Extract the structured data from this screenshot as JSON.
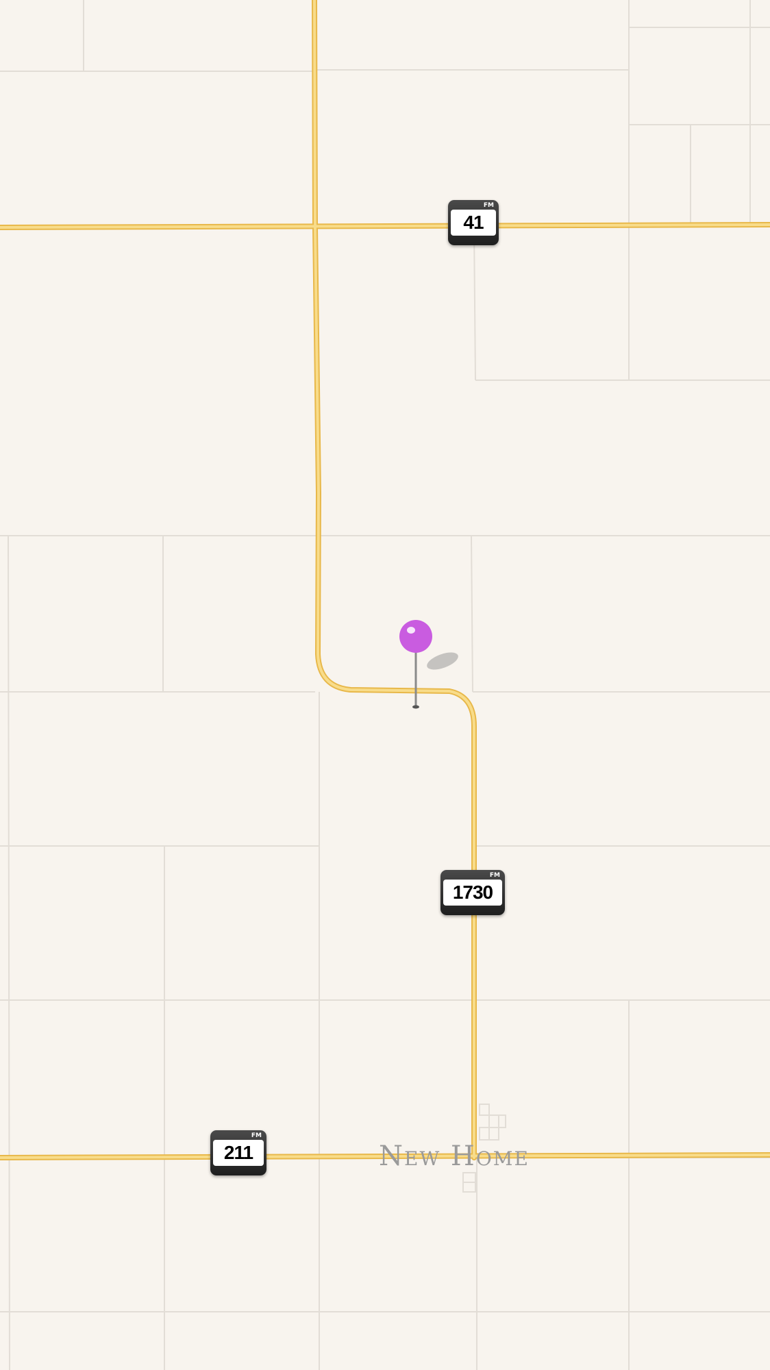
{
  "map": {
    "roads": [
      {
        "shield_type": "FM",
        "number": "41"
      },
      {
        "shield_type": "FM",
        "number": "1730"
      },
      {
        "shield_type": "FM",
        "number": "211"
      }
    ],
    "places": [
      {
        "name": "New Home"
      }
    ],
    "pin": {
      "color": "#c95ce0"
    },
    "colors": {
      "background": "#f8f4ee",
      "major_road": "#f2cc6a",
      "minor_road": "#e2ddd6"
    }
  }
}
